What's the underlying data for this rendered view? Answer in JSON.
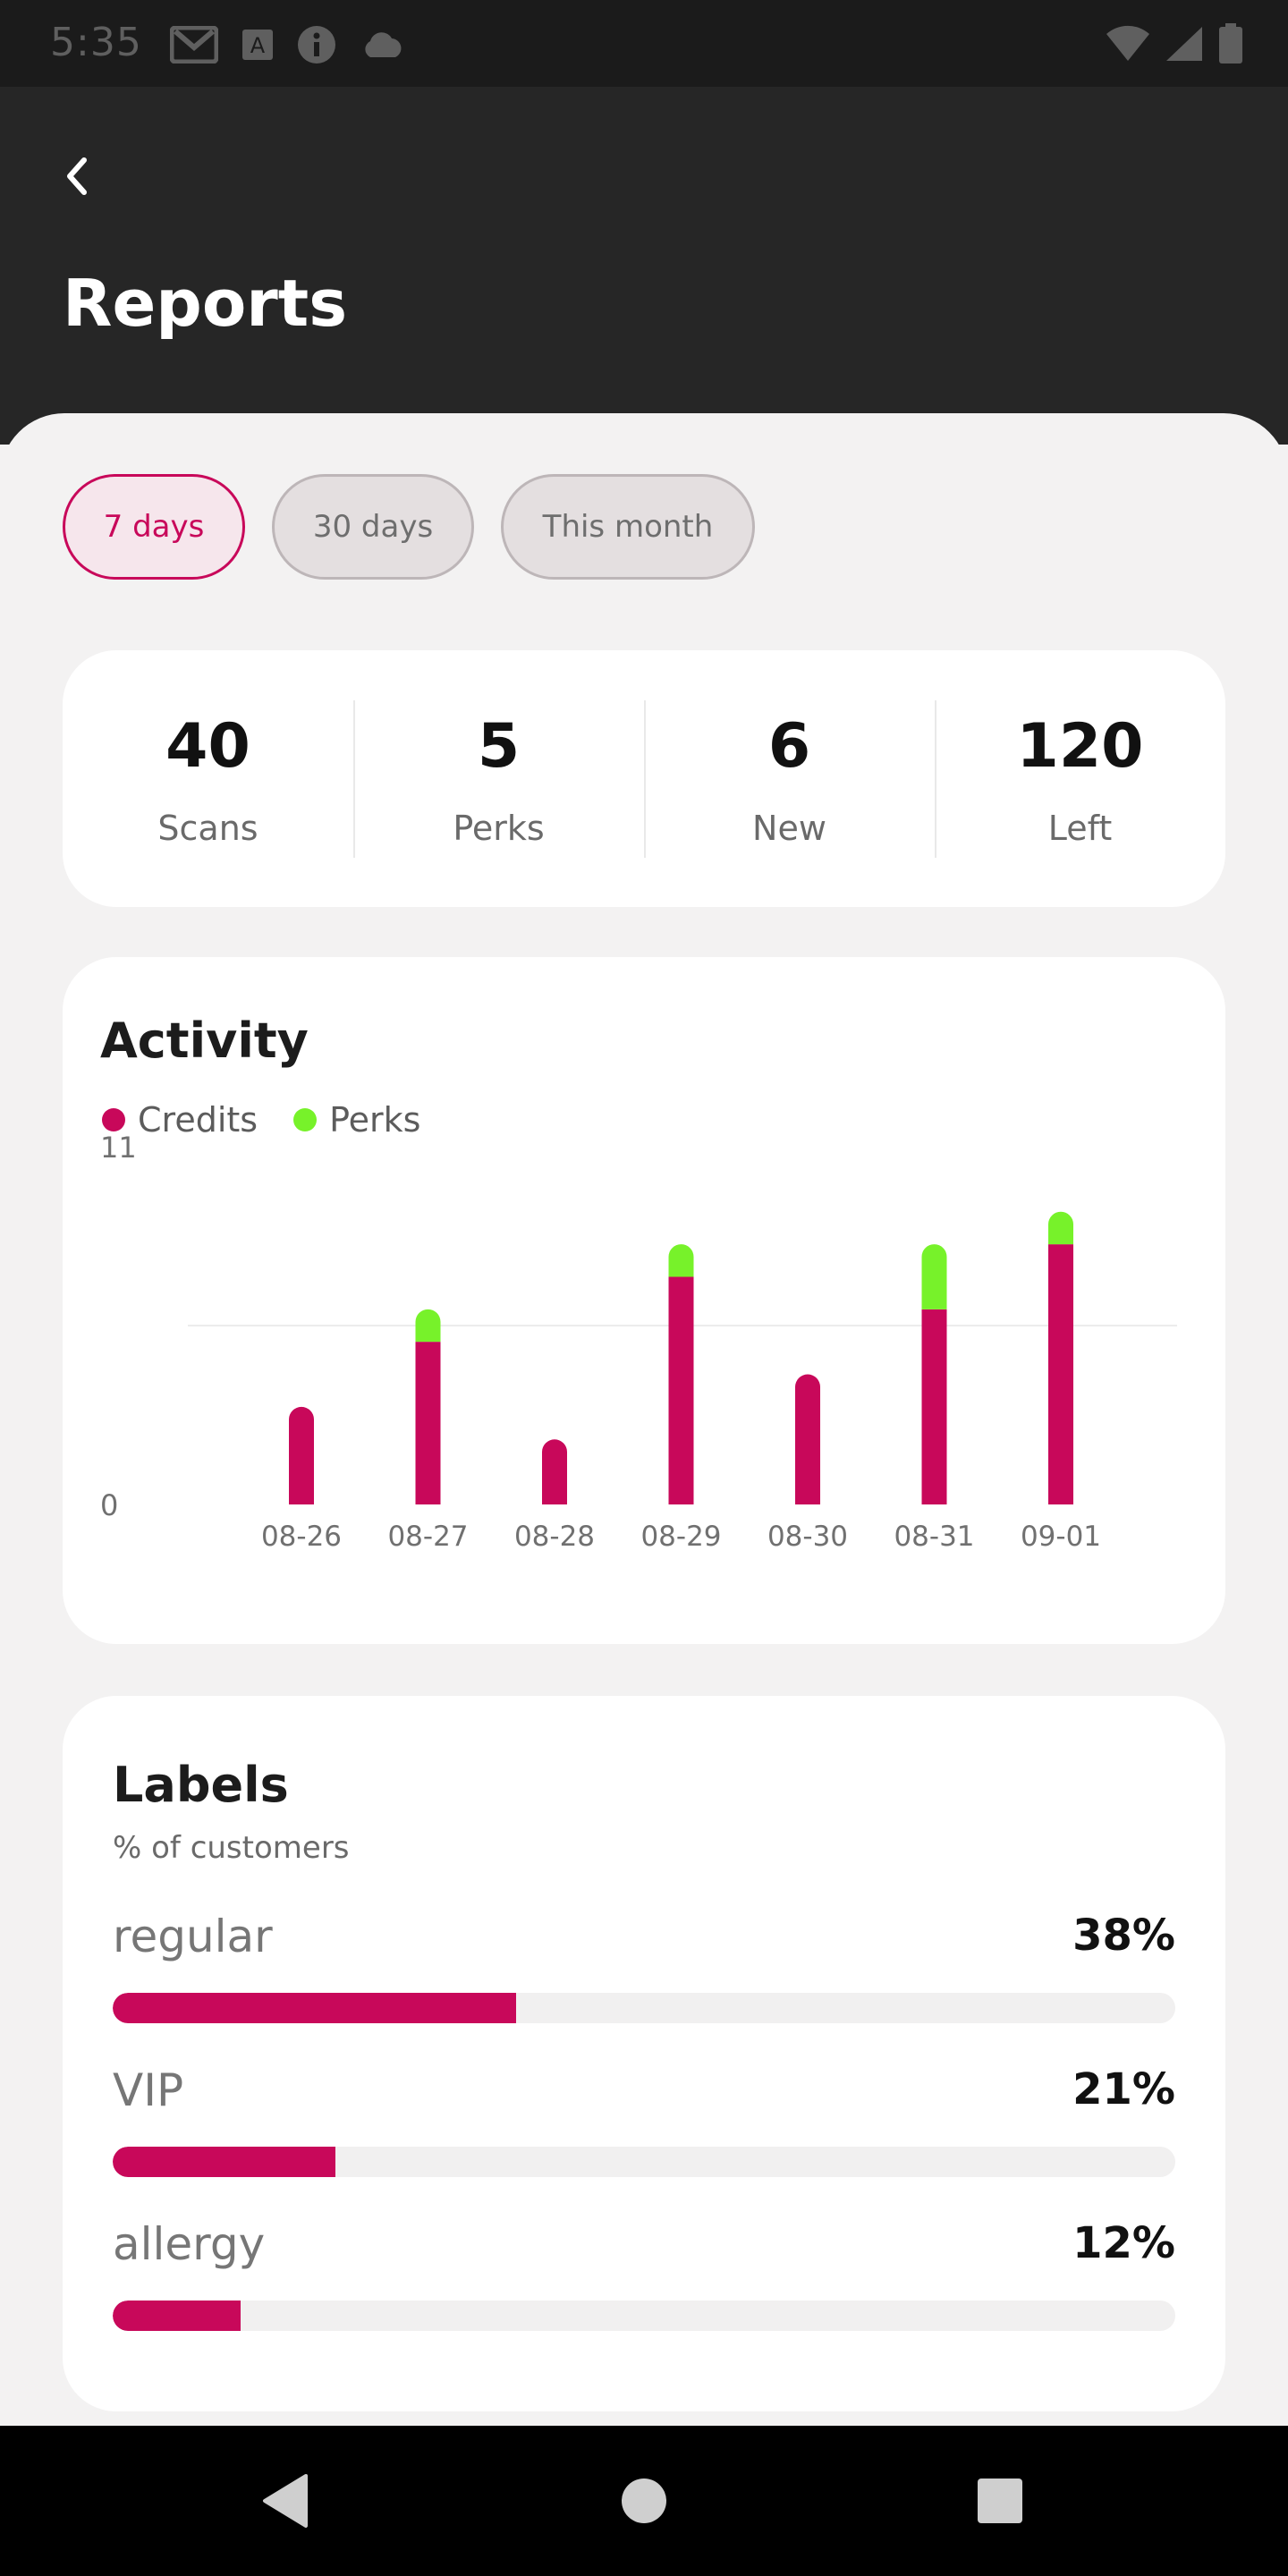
{
  "status_bar": {
    "time": "5:35",
    "left_icons": [
      "gmail-icon",
      "font-a-icon",
      "info-icon",
      "cloud-icon"
    ],
    "right_icons": [
      "wifi-icon",
      "signal-icon",
      "battery-icon"
    ]
  },
  "header": {
    "back_icon": "chevron-left-icon",
    "title": "Reports"
  },
  "filters": [
    {
      "label": "7 days",
      "selected": true
    },
    {
      "label": "30 days",
      "selected": false
    },
    {
      "label": "This month",
      "selected": false
    }
  ],
  "stats": [
    {
      "value": "40",
      "label": "Scans"
    },
    {
      "value": "5",
      "label": "Perks"
    },
    {
      "value": "6",
      "label": "New"
    },
    {
      "value": "120",
      "label": "Left"
    }
  ],
  "activity": {
    "title": "Activity",
    "legend": [
      {
        "name": "Credits",
        "color": "#c8085a"
      },
      {
        "name": "Perks",
        "color": "#77f22a"
      }
    ]
  },
  "chart_data": {
    "type": "bar",
    "stacked": true,
    "categories": [
      "08-26",
      "08-27",
      "08-28",
      "08-29",
      "08-30",
      "08-31",
      "09-01"
    ],
    "series": [
      {
        "name": "Credits",
        "color": "#c8085a",
        "values": [
          3,
          5,
          2,
          7,
          4,
          6,
          8
        ]
      },
      {
        "name": "Perks",
        "color": "#77f22a",
        "values": [
          0,
          1,
          0,
          1,
          0,
          2,
          1
        ]
      }
    ],
    "ylim": [
      0,
      11
    ],
    "yticks": [
      "0",
      "11"
    ],
    "grid": "midline",
    "legend": "top-left"
  },
  "labels_card": {
    "title": "Labels",
    "subtitle": "% of customers",
    "items": [
      {
        "name": "regular",
        "percent_text": "38%",
        "fraction": 0.38
      },
      {
        "name": "VIP",
        "percent_text": "21%",
        "fraction": 0.21
      },
      {
        "name": "allergy",
        "percent_text": "12%",
        "fraction": 0.12
      }
    ],
    "bar_color": "#c8085a"
  },
  "nav_bar": {
    "buttons": [
      "back-triangle-icon",
      "home-circle-icon",
      "recents-square-icon"
    ]
  }
}
